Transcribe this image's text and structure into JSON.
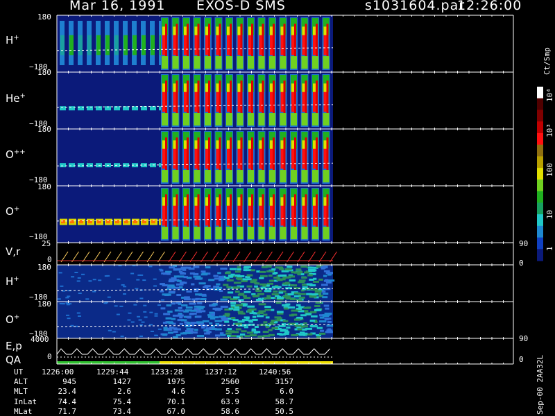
{
  "header": {
    "date": "Mar 16, 1991",
    "mission": "EXOS-D SMS",
    "file": "s1031604.par",
    "time": "12:26:00"
  },
  "colorbar": {
    "unit_label": "Ct/Smp",
    "tick_labels": [
      "1",
      "10",
      "100",
      "10³",
      "10⁴"
    ],
    "colors": [
      "#0b1a7a",
      "#1040c0",
      "#1e88d0",
      "#20c8c8",
      "#18a060",
      "#20b020",
      "#70d020",
      "#e0e000",
      "#b8a000",
      "#907010",
      "#ff1010",
      "#c00000",
      "#800000",
      "#500000",
      "#ffffff"
    ]
  },
  "panels": [
    {
      "label_main": "H",
      "label_sup": "+",
      "y_top": "180",
      "y_bottom": "−180"
    },
    {
      "label_main": "He",
      "label_sup": "+",
      "y_top": "180",
      "y_bottom": "−180"
    },
    {
      "label_main": "O",
      "label_sup": "++",
      "y_top": "180",
      "y_bottom": "−180"
    },
    {
      "label_main": "O",
      "label_sup": "+",
      "y_top": "180",
      "y_bottom": "−180"
    },
    {
      "label_main": "V,r",
      "label_sup": "",
      "y_top": "25",
      "y_bottom": "0",
      "right_top": "90",
      "right_bottom": "0"
    },
    {
      "label_main": "H",
      "label_sup": "+",
      "y_top": "180",
      "y_bottom": "−180"
    },
    {
      "label_main": "O",
      "label_sup": "+",
      "y_top": "180",
      "y_bottom": "−180",
      "right_bottom": "90"
    },
    {
      "label_main": "E,p",
      "label_sup": "",
      "label_extra": "QA",
      "y_top": "4000",
      "y_bottom": "0",
      "right_bottom": "0"
    }
  ],
  "side_note": "Sep-00 2AA32L",
  "ephemeris": {
    "labels": [
      "UT",
      "ALT",
      "MLT",
      "InLat",
      "MLat"
    ],
    "columns": [
      [
        "1226:00",
        "945",
        "23.4",
        "74.4",
        "71.7"
      ],
      [
        "1229:44",
        "1427",
        "2.6",
        "75.4",
        "73.4"
      ],
      [
        "1233:28",
        "1975",
        "4.6",
        "70.1",
        "67.0"
      ],
      [
        "1237:12",
        "2560",
        "5.5",
        "63.9",
        "58.6"
      ],
      [
        "1240:56",
        "3157",
        "6.0",
        "58.7",
        "50.5"
      ]
    ]
  },
  "chart_data": {
    "type": "heatmap",
    "title": "Mar 16, 1991 EXOS-D SMS",
    "x_tick_labels": [
      "1226:00",
      "1229:44",
      "1233:28",
      "1237:12",
      "1240:56"
    ],
    "colorbar_label": "Ct/Smp",
    "colorbar_scale": "log",
    "colorbar_range": [
      1,
      10000
    ],
    "panels": [
      "H+",
      "He+",
      "O++",
      "O+",
      "V,r",
      "H+",
      "O+",
      "E,p QA"
    ]
  }
}
